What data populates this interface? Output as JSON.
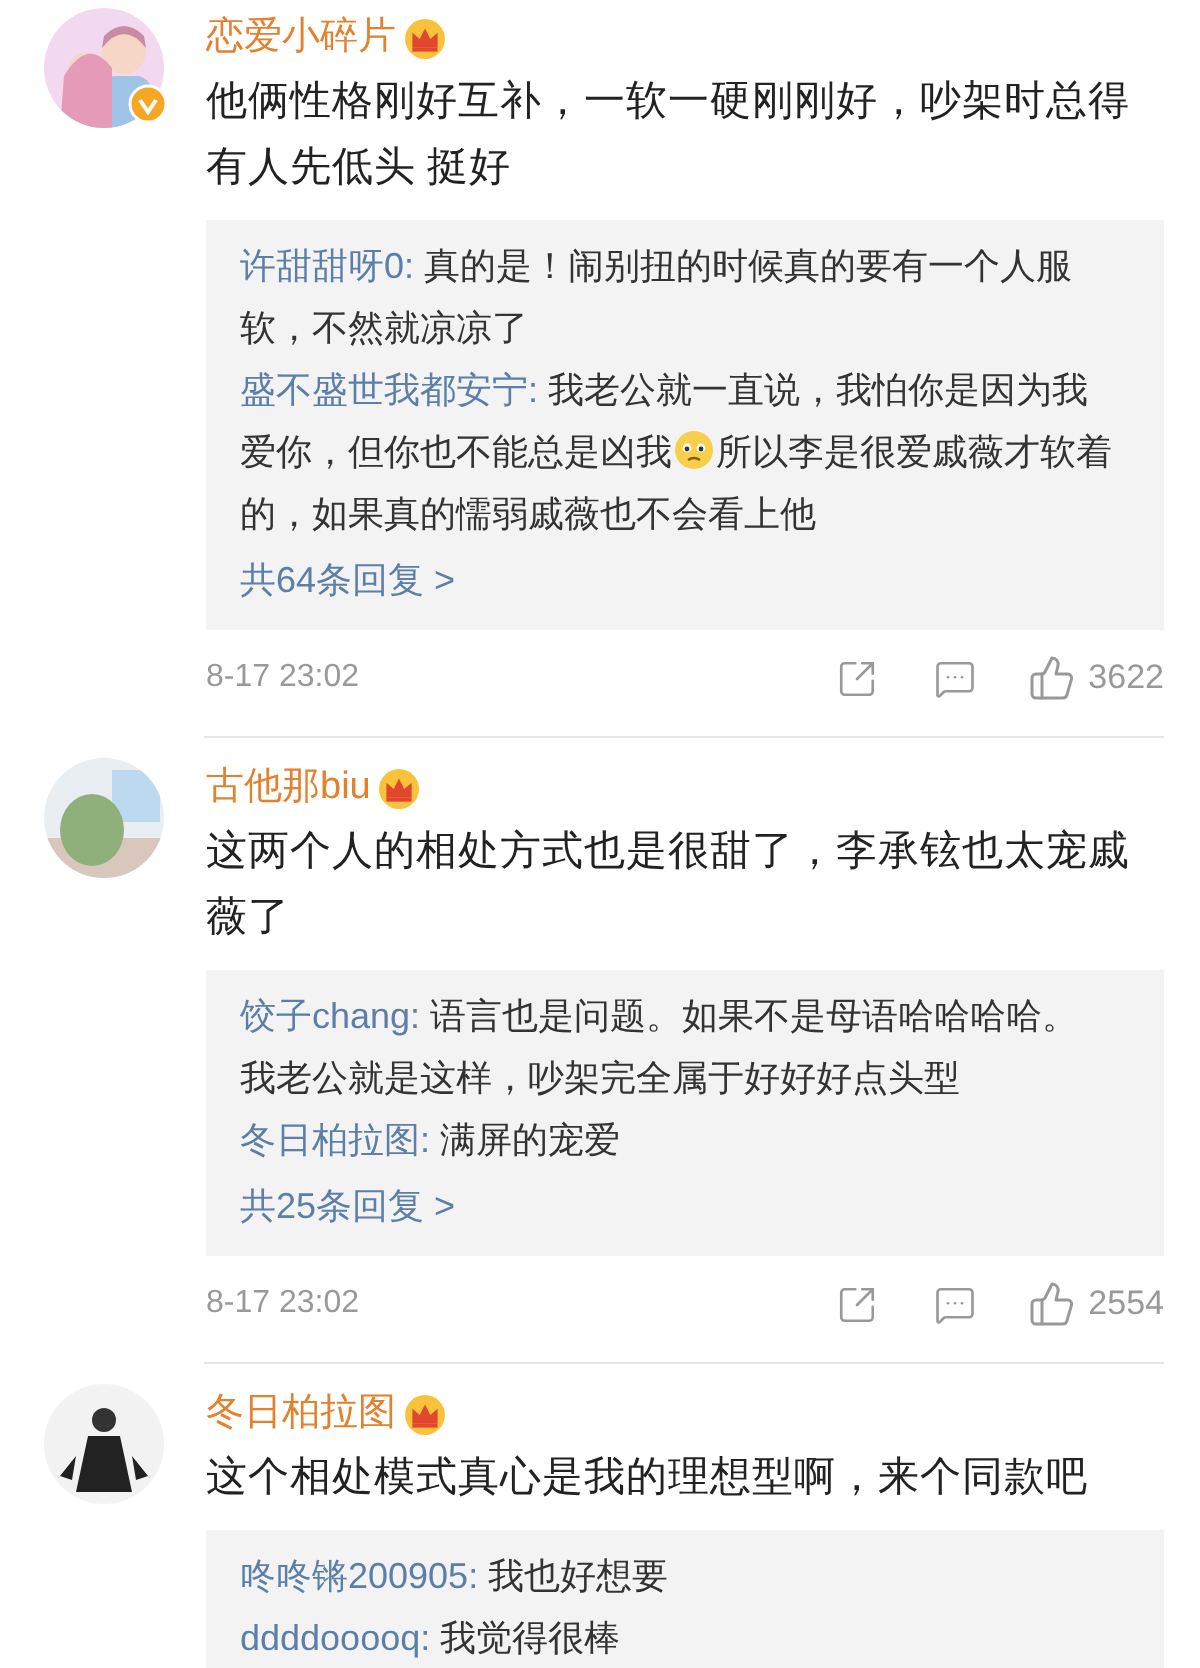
{
  "comments": [
    {
      "username": "恋爱小碎片",
      "verified": true,
      "text": "他俩性格刚好互补，一软一硬刚刚好，吵架时总得有人先低头 挺好",
      "replies": [
        {
          "user": "许甜甜呀0:",
          "parts": [
            "真的是！闹别扭的时候真的要有一个人服软，不然就凉凉了"
          ]
        },
        {
          "user": "盛不盛世我都安宁:",
          "parts": [
            "我老公就一直说，我怕你是因为我爱你，但你也不能总是凶我",
            "所以李是很爱戚薇才软着的，如果真的懦弱戚薇也不会看上他"
          ]
        }
      ],
      "more_replies": "共64条回复 >",
      "time": "8-17 23:02",
      "likes": "3622"
    },
    {
      "username": "古他那biu",
      "verified": false,
      "text": "这两个人的相处方式也是很甜了，李承铉也太宠戚薇了",
      "replies": [
        {
          "user": "饺子chang:",
          "parts": [
            "语言也是问题。如果不是母语哈哈哈哈。我老公就是这样，吵架完全属于好好好点头型"
          ]
        },
        {
          "user": "冬日柏拉图:",
          "parts": [
            "满屏的宠爱"
          ]
        }
      ],
      "more_replies": "共25条回复 >",
      "time": "8-17 23:02",
      "likes": "2554"
    },
    {
      "username": "冬日柏拉图",
      "verified": false,
      "text": "这个相处模式真心是我的理想型啊，来个同款吧",
      "replies": [
        {
          "user": "咚咚锵200905:",
          "parts": [
            "我也好想要"
          ]
        },
        {
          "user": "ddddooooq:",
          "parts": [
            "我觉得很棒"
          ]
        }
      ]
    }
  ]
}
